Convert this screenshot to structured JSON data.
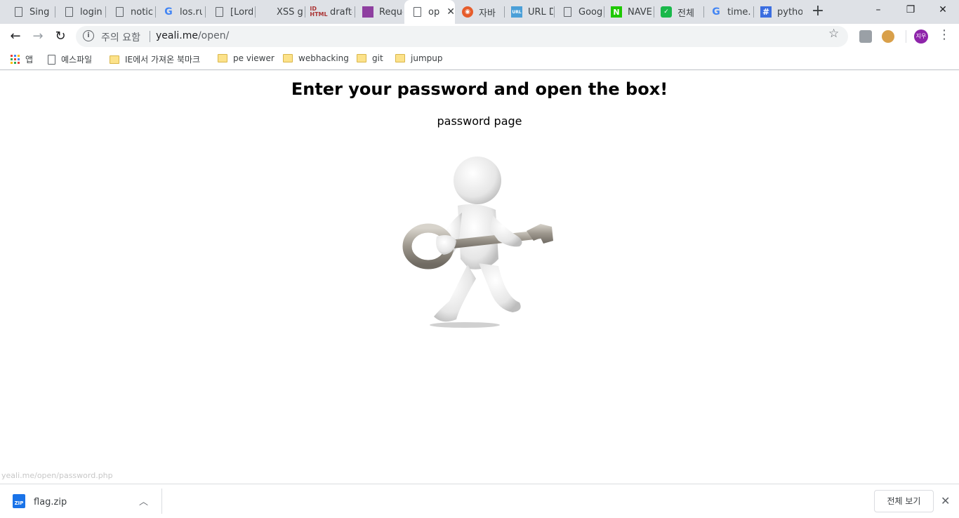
{
  "tabs": [
    {
      "label": "Sing",
      "icon": "page-icon"
    },
    {
      "label": "login",
      "icon": "page-icon"
    },
    {
      "label": "notic",
      "icon": "page-icon"
    },
    {
      "label": "los.ru",
      "icon": "google-icon"
    },
    {
      "label": "[Lord",
      "icon": "page-icon"
    },
    {
      "label": "XSS g",
      "icon": "none"
    },
    {
      "label": "draft-",
      "icon": "id-html-icon"
    },
    {
      "label": "Reque",
      "icon": "purple-square-icon"
    },
    {
      "label": "op",
      "icon": "page-icon",
      "active": true
    },
    {
      "label": "자바",
      "icon": "orange-icon"
    },
    {
      "label": "URL D",
      "icon": "url-icon"
    },
    {
      "label": "Goog",
      "icon": "page-icon"
    },
    {
      "label": "NAVE",
      "icon": "naver-icon"
    },
    {
      "label": "전체",
      "icon": "green-icon"
    },
    {
      "label": "time.",
      "icon": "google-icon"
    },
    {
      "label": "pytho",
      "icon": "hash-icon"
    }
  ],
  "window_controls": {
    "minimize": "–",
    "restore": "❐",
    "close": "✕"
  },
  "toolbar": {
    "security_warning": "주의 요함",
    "url_host": "yeali.me",
    "url_path": "/open/",
    "avatar_initials": "지우"
  },
  "bookmarks": [
    {
      "label": "앱",
      "icon": "apps-grid-icon"
    },
    {
      "label": "예스파일",
      "icon": "page-icon"
    },
    {
      "label": "IE에서 가져온 북마크",
      "icon": "folder-icon"
    },
    {
      "label": "pe viewer",
      "icon": "folder-icon"
    },
    {
      "label": "webhacking",
      "icon": "folder-icon"
    },
    {
      "label": "git",
      "icon": "folder-icon"
    },
    {
      "label": "jumpup",
      "icon": "folder-icon"
    }
  ],
  "page": {
    "heading": "Enter your password and open the box!",
    "subtext": "password page",
    "image": "man-with-key-illustration"
  },
  "status_url": "yeali.me/open/password.php",
  "downloads": {
    "file_name": "flag.zip",
    "file_icon_text": "ZIP",
    "show_all": "전체 보기"
  }
}
